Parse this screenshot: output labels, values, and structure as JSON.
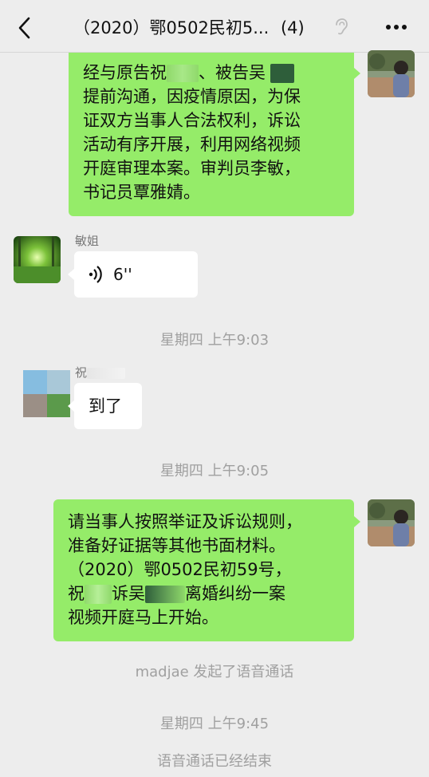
{
  "header": {
    "back_icon": "chevron-left-icon",
    "title": "（2020）鄂0502民初5...",
    "member_count": "(4)",
    "ear_icon": "ear-icon",
    "more_icon": "more-icon"
  },
  "messages": {
    "msg1": {
      "line1_a": "经与原告祝",
      "line1_b": "、被告吴",
      "lines": [
        "提前沟通，因疫情原因，为保",
        "证双方当事人合法权利，诉讼",
        "活动有序开展，利用网络视频",
        "开庭审理本案。审判员李敏，",
        "书记员覃雅婧。"
      ]
    },
    "msg2": {
      "sender": "敏姐",
      "voice_duration": "6''",
      "voice_icon": "voice-wave-icon"
    },
    "time1": "星期四 上午9:03",
    "msg3": {
      "sender": "祝",
      "text": "到了"
    },
    "time2": "星期四 上午9:05",
    "msg4": {
      "lines": [
        "请当事人按照举证及诉讼规则，",
        "准备好证据等其他书面材料。",
        "（2020）鄂0502民初59号，"
      ],
      "line4_a": "祝",
      "line4_b": "诉吴",
      "line4_c": "离婚纠纷一案",
      "line5": "视频开庭马上开始。"
    },
    "system1": "madjae 发起了语音通话",
    "time3": "星期四 上午9:45",
    "system2": "语音通话已经结束"
  },
  "colors": {
    "sent_bubble": "#95ec69",
    "received_bubble": "#ffffff",
    "background": "#ededed"
  }
}
